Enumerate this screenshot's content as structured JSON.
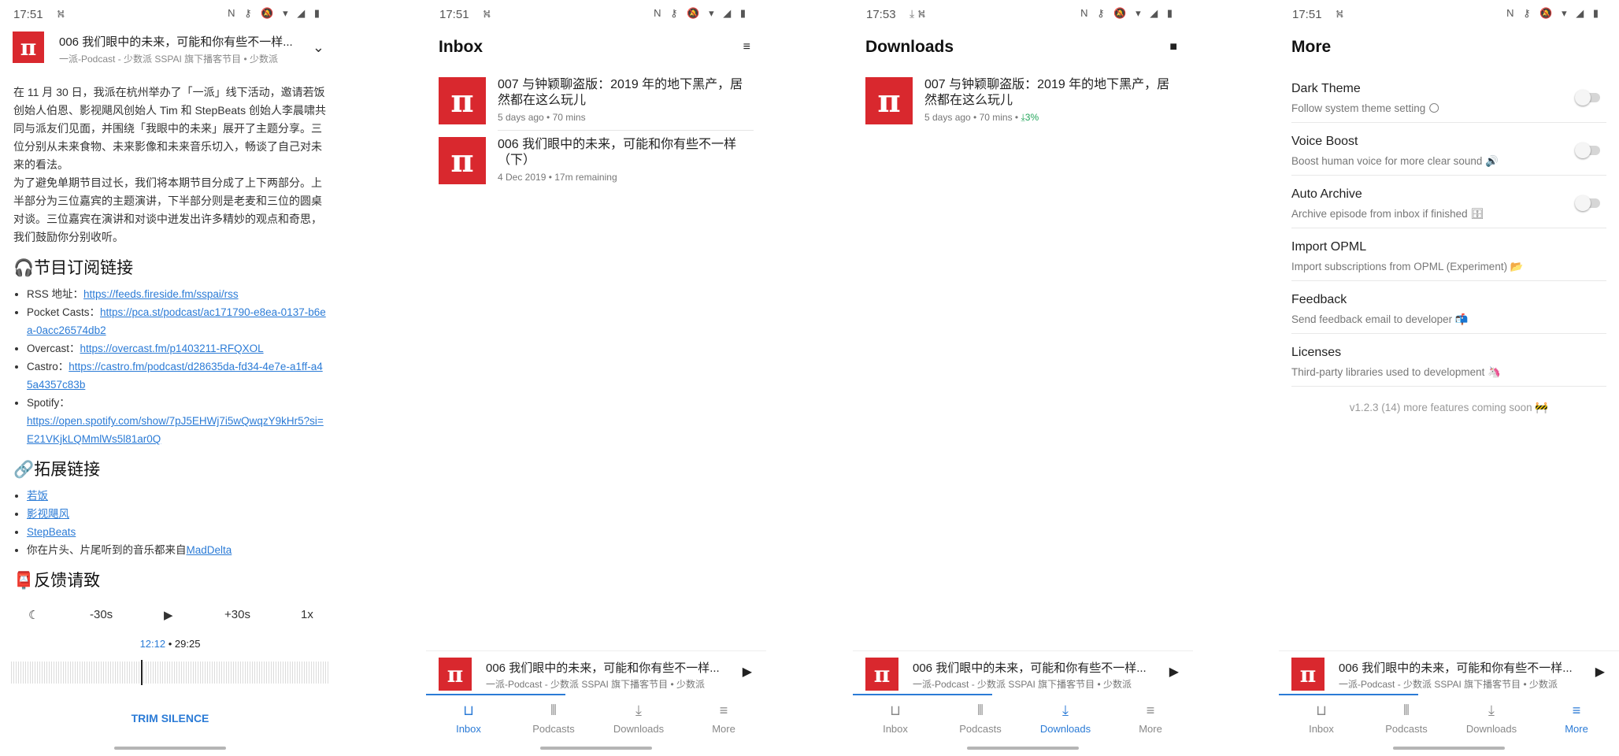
{
  "status": {
    "time_1": "17:51",
    "time_2": "17:51",
    "time_3": "17:53",
    "time_4": "17:51",
    "right_icons": "N ⚷ 🔕 ▾ ◢ ▮"
  },
  "detail": {
    "header_title": "006 我们眼中的未来，可能和你有些不一样...",
    "header_sub": "一派-Podcast - 少数派 SSPAI 旗下播客节目 • 少数派",
    "para1": "在 11 月 30 日，我派在杭州举办了「一派」线下活动，邀请若饭创始人伯恩、影视飓风创始人 Tim 和 StepBeats 创始人李晨啸共同与派友们见面，并围绕「我眼中的未来」展开了主题分享。三位分别从未来食物、未来影像和未来音乐切入，畅谈了自己对未来的看法。",
    "para2": "为了避免单期节目过长，我们将本期节目分成了上下两部分。上半部分为三位嘉宾的主题演讲，下半部分则是老麦和三位的圆桌对谈。三位嘉宾在演讲和对谈中迸发出许多精妙的观点和奇思，我们鼓励你分别收听。",
    "h_subscribe": "🎧节目订阅链接",
    "links": [
      {
        "label": "RSS 地址：",
        "url": "https://feeds.fireside.fm/sspai/rss"
      },
      {
        "label": "Pocket Casts：",
        "url": "https://pca.st/podcast/ac171790-e8ea-0137-b6ea-0acc26574db2"
      },
      {
        "label": "Overcast：",
        "url": "https://overcast.fm/p1403211-RFQXOL"
      },
      {
        "label": "Castro：",
        "url": "https://castro.fm/podcast/d28635da-fd34-4e7e-a1ff-a45a4357c83b"
      },
      {
        "label": "Spotify：",
        "url": "https://open.spotify.com/show/7pJ5EHWj7i5wQwqzY9kHr5?si=E21VKjkLQMmlWs5l81ar0Q"
      }
    ],
    "h_ext": "🔗拓展链接",
    "ext": [
      "若饭",
      "影视飓风",
      "StepBeats"
    ],
    "ext_music_prefix": "你在片头、片尾听到的音乐都来自",
    "ext_music_link": "MadDelta",
    "h_feedback": "📮反馈请致",
    "controls": {
      "sleep": "☾",
      "back": "-30s",
      "play": "▶",
      "fwd": "+30s",
      "speed": "1x"
    },
    "position": "12:12",
    "sep": " • ",
    "duration": "29:25",
    "trim": "TRIM SILENCE"
  },
  "inbox": {
    "title": "Inbox",
    "action_icon": "≡",
    "items": [
      {
        "title": "007 与钟颖聊盗版：2019 年的地下黑产，居然都在这么玩儿",
        "meta": "5 days ago • 70 mins"
      },
      {
        "title": "006 我们眼中的未来，可能和你有些不一样（下）",
        "meta": "4 Dec 2019 • 17m remaining"
      }
    ]
  },
  "downloads": {
    "title": "Downloads",
    "action_icon": "■",
    "items": [
      {
        "title": "007 与钟颖聊盗版：2019 年的地下黑产，居然都在这么玩儿",
        "meta": "5 days ago • 70 mins • ",
        "pct": "⤓3%"
      }
    ]
  },
  "more": {
    "title": "More",
    "settings": [
      {
        "title": "Dark Theme",
        "desc": "Follow system theme setting 🌕"
      },
      {
        "title": "Voice Boost",
        "desc": "Boost human voice for more clear sound 🔊"
      },
      {
        "title": "Auto Archive",
        "desc": "Archive episode from inbox if finished 🗄"
      },
      {
        "title": "Import OPML",
        "desc": "Import subscriptions from OPML (Experiment) 📂"
      },
      {
        "title": "Feedback",
        "desc": "Send feedback email to developer 📬"
      },
      {
        "title": "Licenses",
        "desc": "Third-party libraries used to development 🦄"
      }
    ],
    "version": "v1.2.3 (14) more features coming soon 🚧"
  },
  "mini": {
    "title": "006 我们眼中的未来，可能和你有些不一样...",
    "sub": "一派-Podcast - 少数派 SSPAI 旗下播客节目 • 少数派",
    "play": "▶",
    "progress": 0.41
  },
  "nav": {
    "inbox": "Inbox",
    "podcasts": "Podcasts",
    "downloads": "Downloads",
    "more": "More"
  },
  "logo_char": "π",
  "colors": {
    "accent": "#2b7bd6",
    "brand": "#d9282e",
    "success": "#22a55a"
  }
}
